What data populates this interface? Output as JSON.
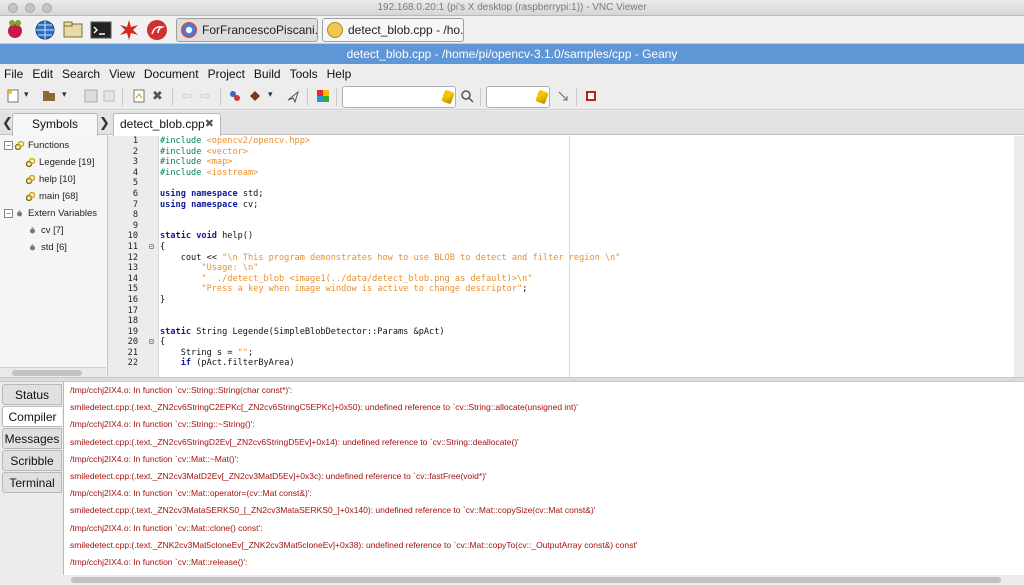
{
  "vnc": {
    "title": "192.168.0.20:1 (pi's X desktop (raspberrypi:1)) - VNC Viewer"
  },
  "taskbar": {
    "tasks": [
      {
        "label": "ForFrancescoPiscani..."
      },
      {
        "label": "detect_blob.cpp - /ho..."
      }
    ]
  },
  "window": {
    "title": "detect_blob.cpp - /home/pi/opencv-3.1.0/samples/cpp - Geany"
  },
  "menu": [
    "File",
    "Edit",
    "Search",
    "View",
    "Document",
    "Project",
    "Build",
    "Tools",
    "Help"
  ],
  "sidebar": {
    "tab_label": "Symbols",
    "tree": [
      {
        "label": "Functions",
        "level": 0,
        "icon": "functions-icon"
      },
      {
        "label": "Legende [19]",
        "level": 1,
        "icon": "function-icon"
      },
      {
        "label": "help [10]",
        "level": 1,
        "icon": "function-icon"
      },
      {
        "label": "main [68]",
        "level": 1,
        "icon": "function-icon"
      },
      {
        "label": "Extern Variables",
        "level": 0,
        "icon": "variables-icon"
      },
      {
        "label": "cv [7]",
        "level": 1,
        "icon": "variable-icon"
      },
      {
        "label": "std [6]",
        "level": 1,
        "icon": "variable-icon"
      }
    ]
  },
  "editor": {
    "tab_label": "detect_blob.cpp",
    "lines": [
      "#include <opencv2/opencv.hpp>",
      "#include <vector>",
      "#include <map>",
      "#include <iostream>",
      "",
      "using namespace std;",
      "using namespace cv;",
      "",
      "",
      "static void help()",
      "{",
      "    cout << \"\\n This program demonstrates how to use BLOB to detect and filter region \\n\"",
      "        \"Usage: \\n\"",
      "        \"  ./detect_blob <image1(../data/detect_blob.png as default)>\\n\"",
      "        \"Press a key when image window is active to change descriptor\";",
      "}",
      "",
      "",
      "static String Legende(SimpleBlobDetector::Params &pAct)",
      "{",
      "    String s = \"\";",
      "    if (pAct.filterByArea)"
    ]
  },
  "messages": {
    "tabs": [
      "Status",
      "Compiler",
      "Messages",
      "Scribble",
      "Terminal"
    ],
    "active_tab": "Compiler",
    "lines": [
      "/tmp/cchj2IX4.o: In function `cv::String::String(char const*)':",
      "smiledetect.cpp:(.text._ZN2cv6StringC2EPKc[_ZN2cv6StringC5EPKc]+0x50): undefined reference to `cv::String::allocate(unsigned int)'",
      "/tmp/cchj2IX4.o: In function `cv::String::~String()':",
      "smiledetect.cpp:(.text._ZN2cv6StringD2Ev[_ZN2cv6StringD5Ev]+0x14): undefined reference to `cv::String::deallocate()'",
      "/tmp/cchj2IX4.o: In function `cv::Mat::~Mat()':",
      "smiledetect.cpp:(.text._ZN2cv3MatD2Ev[_ZN2cv3MatD5Ev]+0x3c): undefined reference to `cv::fastFree(void*)'",
      "/tmp/cchj2IX4.o: In function `cv::Mat::operator=(cv::Mat const&)':",
      "smiledetect.cpp:(.text._ZN2cv3MataSERKS0_[_ZN2cv3MataSERKS0_]+0x140): undefined reference to `cv::Mat::copySize(cv::Mat const&)'",
      "/tmp/cchj2IX4.o: In function `cv::Mat::clone() const':",
      "smiledetect.cpp:(.text._ZNK2cv3Mat5cloneEv[_ZNK2cv3Mat5cloneEv]+0x38): undefined reference to `cv::Mat::copyTo(cv::_OutputArray const&) const'",
      "/tmp/cchj2IX4.o: In function `cv::Mat::release()':"
    ]
  }
}
